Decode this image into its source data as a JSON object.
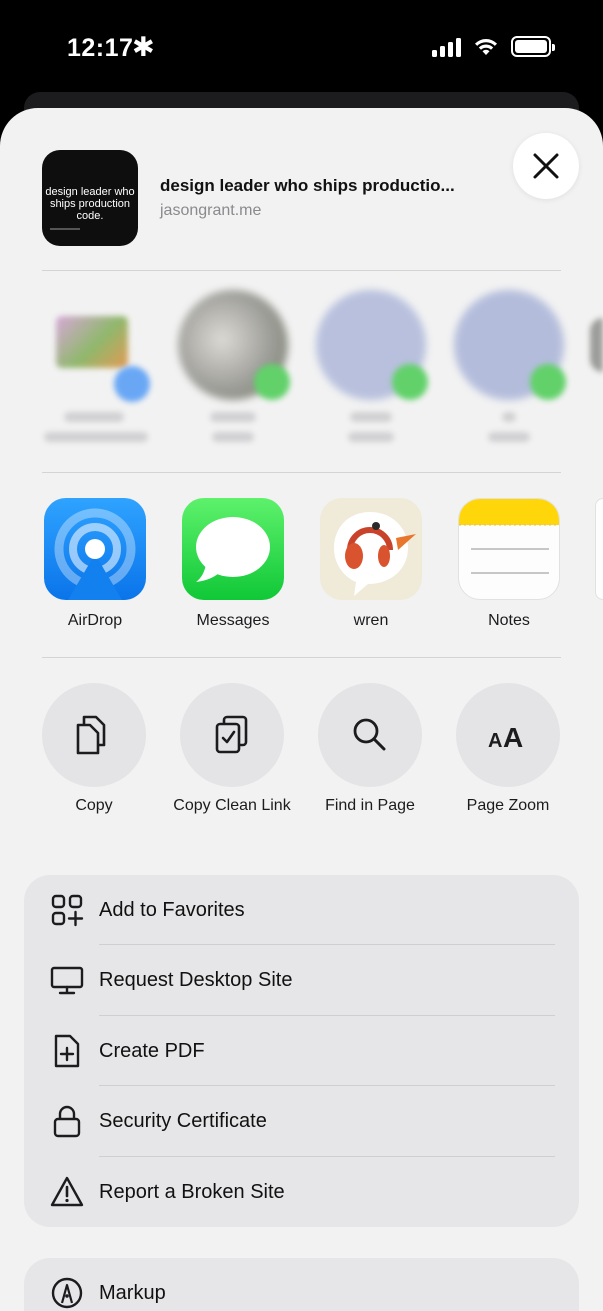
{
  "status_bar": {
    "time": "12:17",
    "time_symbol": "✱"
  },
  "share_header": {
    "thumbnail_text": "design leader who ships production code.",
    "title": "design leader who ships productio...",
    "url": "jasongrant.me"
  },
  "apps": [
    {
      "label": "AirDrop",
      "icon": "airdrop-icon",
      "color": "#1e8bf6"
    },
    {
      "label": "Messages",
      "icon": "messages-icon",
      "color": "#2bd94a"
    },
    {
      "label": "wren",
      "icon": "wren-icon",
      "color": "#efe9d9"
    },
    {
      "label": "Notes",
      "icon": "notes-icon",
      "color": "#ffd60a"
    }
  ],
  "actions": [
    {
      "label": "Copy",
      "icon": "copy-icon"
    },
    {
      "label": "Copy Clean Link",
      "icon": "copy-clean-link-icon"
    },
    {
      "label": "Find in Page",
      "icon": "search-icon"
    },
    {
      "label": "Page Zoom",
      "icon": "text-size-icon"
    }
  ],
  "menu": [
    {
      "label": "Add to Favorites",
      "icon": "add-favorites-icon"
    },
    {
      "label": "Request Desktop Site",
      "icon": "desktop-icon"
    },
    {
      "label": "Create PDF",
      "icon": "pdf-add-icon"
    },
    {
      "label": "Security Certificate",
      "icon": "lock-icon"
    },
    {
      "label": "Report a Broken Site",
      "icon": "warning-icon"
    }
  ],
  "menu2": [
    {
      "label": "Markup",
      "icon": "markup-icon"
    }
  ]
}
